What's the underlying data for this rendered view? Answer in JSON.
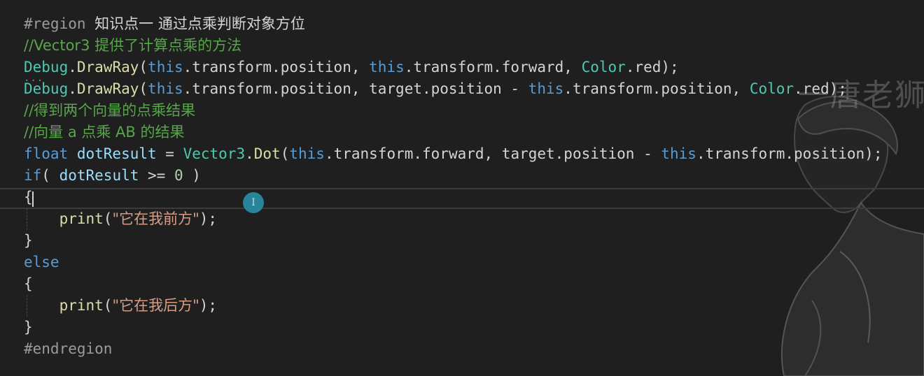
{
  "watermark": "一唐老狮",
  "lines": {
    "l1": {
      "pp": "#region",
      "title": "知识点一 通过点乘判断对象方位"
    },
    "l2": {
      "comment": "//Vector3 提供了计算点乘的方法"
    },
    "l3": {
      "a": "Debug",
      "b": ".",
      "c": "DrawRay",
      "d": "(",
      "e": "this",
      "f": ".transform.position, ",
      "g": "this",
      "h": ".transform.forward, ",
      "i": "Color",
      "j": ".red);"
    },
    "l4": {
      "a": "Debug",
      "b": ".",
      "c": "DrawRay",
      "d": "(",
      "e": "this",
      "f": ".transform.position, target.position - ",
      "g": "this",
      "h": ".transform.position, ",
      "i": "Color",
      "j": ".red);"
    },
    "l5": {
      "comment": "//得到两个向量的点乘结果"
    },
    "l6": {
      "comment": "//向量 a 点乘 AB 的结果"
    },
    "l7": {
      "a": "float",
      "b": " dotResult",
      "c": " = ",
      "d": "Vector3",
      "e": ".",
      "f": "Dot",
      "g": "(",
      "h": "this",
      "i": ".transform.forward, target.position - ",
      "j": "this",
      "k": ".transform.position);"
    },
    "l8": {
      "a": "if",
      "b": "( ",
      "c": "dotResult",
      "d": " >= ",
      "e": "0",
      "f": " )"
    },
    "l9": {
      "a": "{"
    },
    "l10": {
      "fn": "print",
      "open": "(",
      "str": "\"它在我前方\"",
      "close": ");"
    },
    "l11": {
      "a": "}"
    },
    "l12": {
      "a": "else"
    },
    "l13": {
      "a": "{"
    },
    "l14": {
      "fn": "print",
      "open": "(",
      "str": "\"它在我后方\"",
      "close": ");"
    },
    "l15": {
      "a": "}"
    },
    "l16": {
      "pp": "#endregion"
    }
  },
  "colors": {
    "background": "#1f1f1f",
    "keyword": "#569cd6",
    "type": "#4ec9b0",
    "method": "#dcdcaa",
    "comment": "#57a64a",
    "string": "#d69d85",
    "number": "#b5cea8",
    "cursor_indicator": "#2a8fa8"
  }
}
